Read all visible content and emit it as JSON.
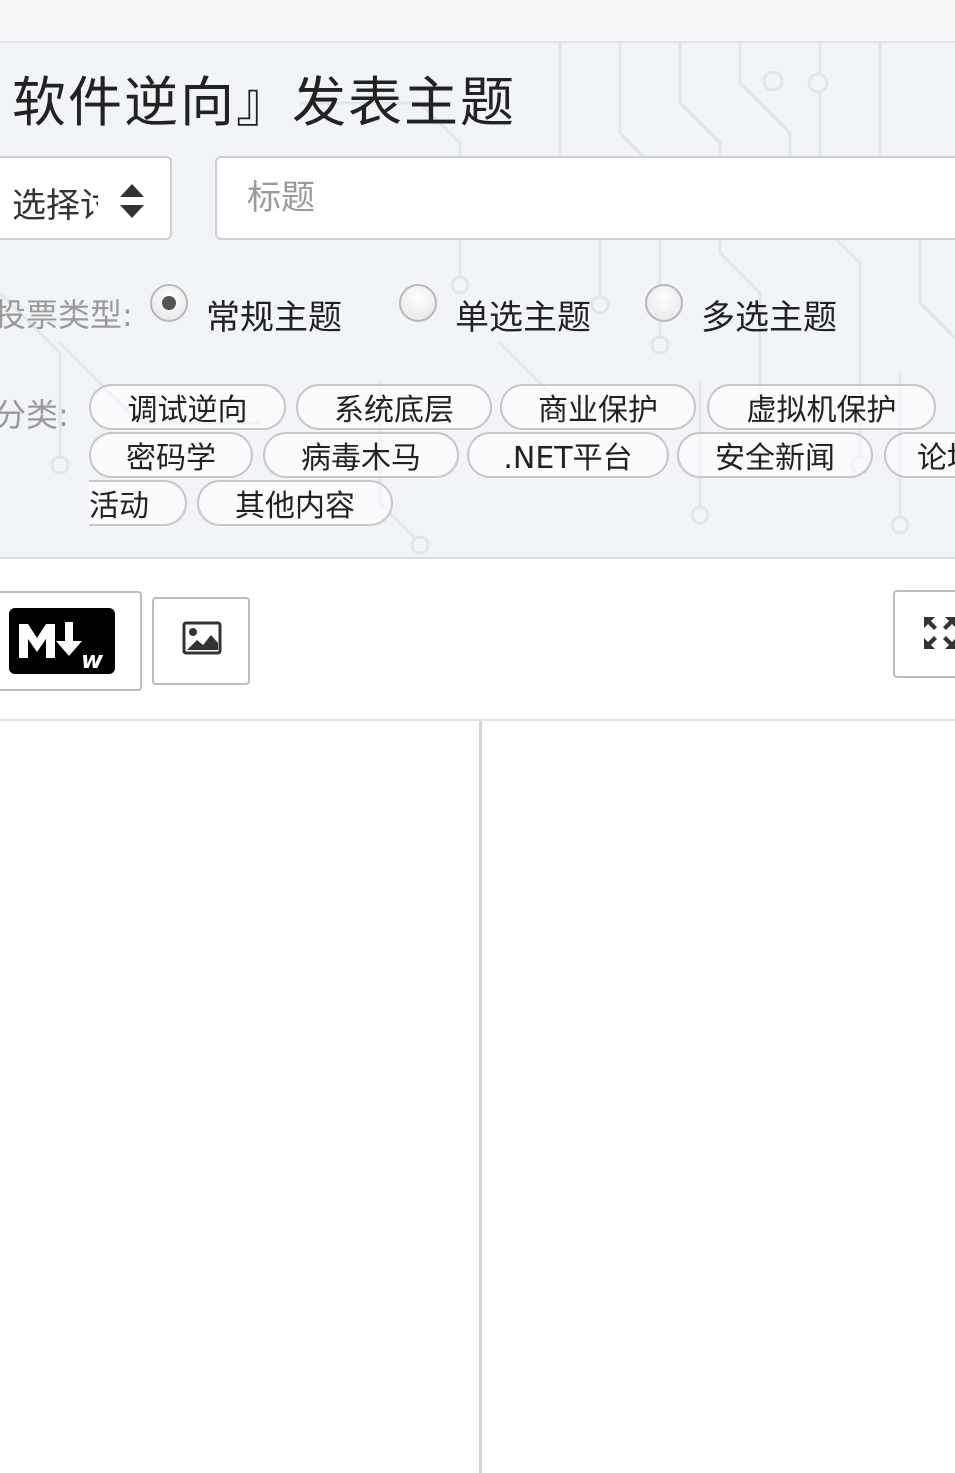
{
  "page": {
    "title": "软件逆向』发表主题"
  },
  "form": {
    "category_select": {
      "value": "选择讨"
    },
    "title_input": {
      "placeholder": "标题"
    },
    "vote_type": {
      "label": "投票类型:",
      "options": [
        {
          "label": "常规主题",
          "checked": true
        },
        {
          "label": "单选主题",
          "checked": false
        },
        {
          "label": "多选主题",
          "checked": false
        }
      ]
    },
    "categories": {
      "label": "分类:",
      "tags": [
        "调试逆向",
        "系统底层",
        "商业保护",
        "虚拟机保护",
        "密码学",
        "病毒木马",
        ".NET平台",
        "安全新闻",
        "论坛",
        "活动",
        "其他内容"
      ]
    }
  },
  "toolbar": {
    "markdown_icon": "markdown-icon",
    "image_icon": "image-icon",
    "fullscreen_icon": "fullscreen-icon"
  },
  "editor": {
    "input_text": "",
    "preview_text": ""
  },
  "colors": {
    "header_bg": "#f1f5f8",
    "border": "#cfcfcf",
    "muted_text": "#9a9a9a"
  }
}
